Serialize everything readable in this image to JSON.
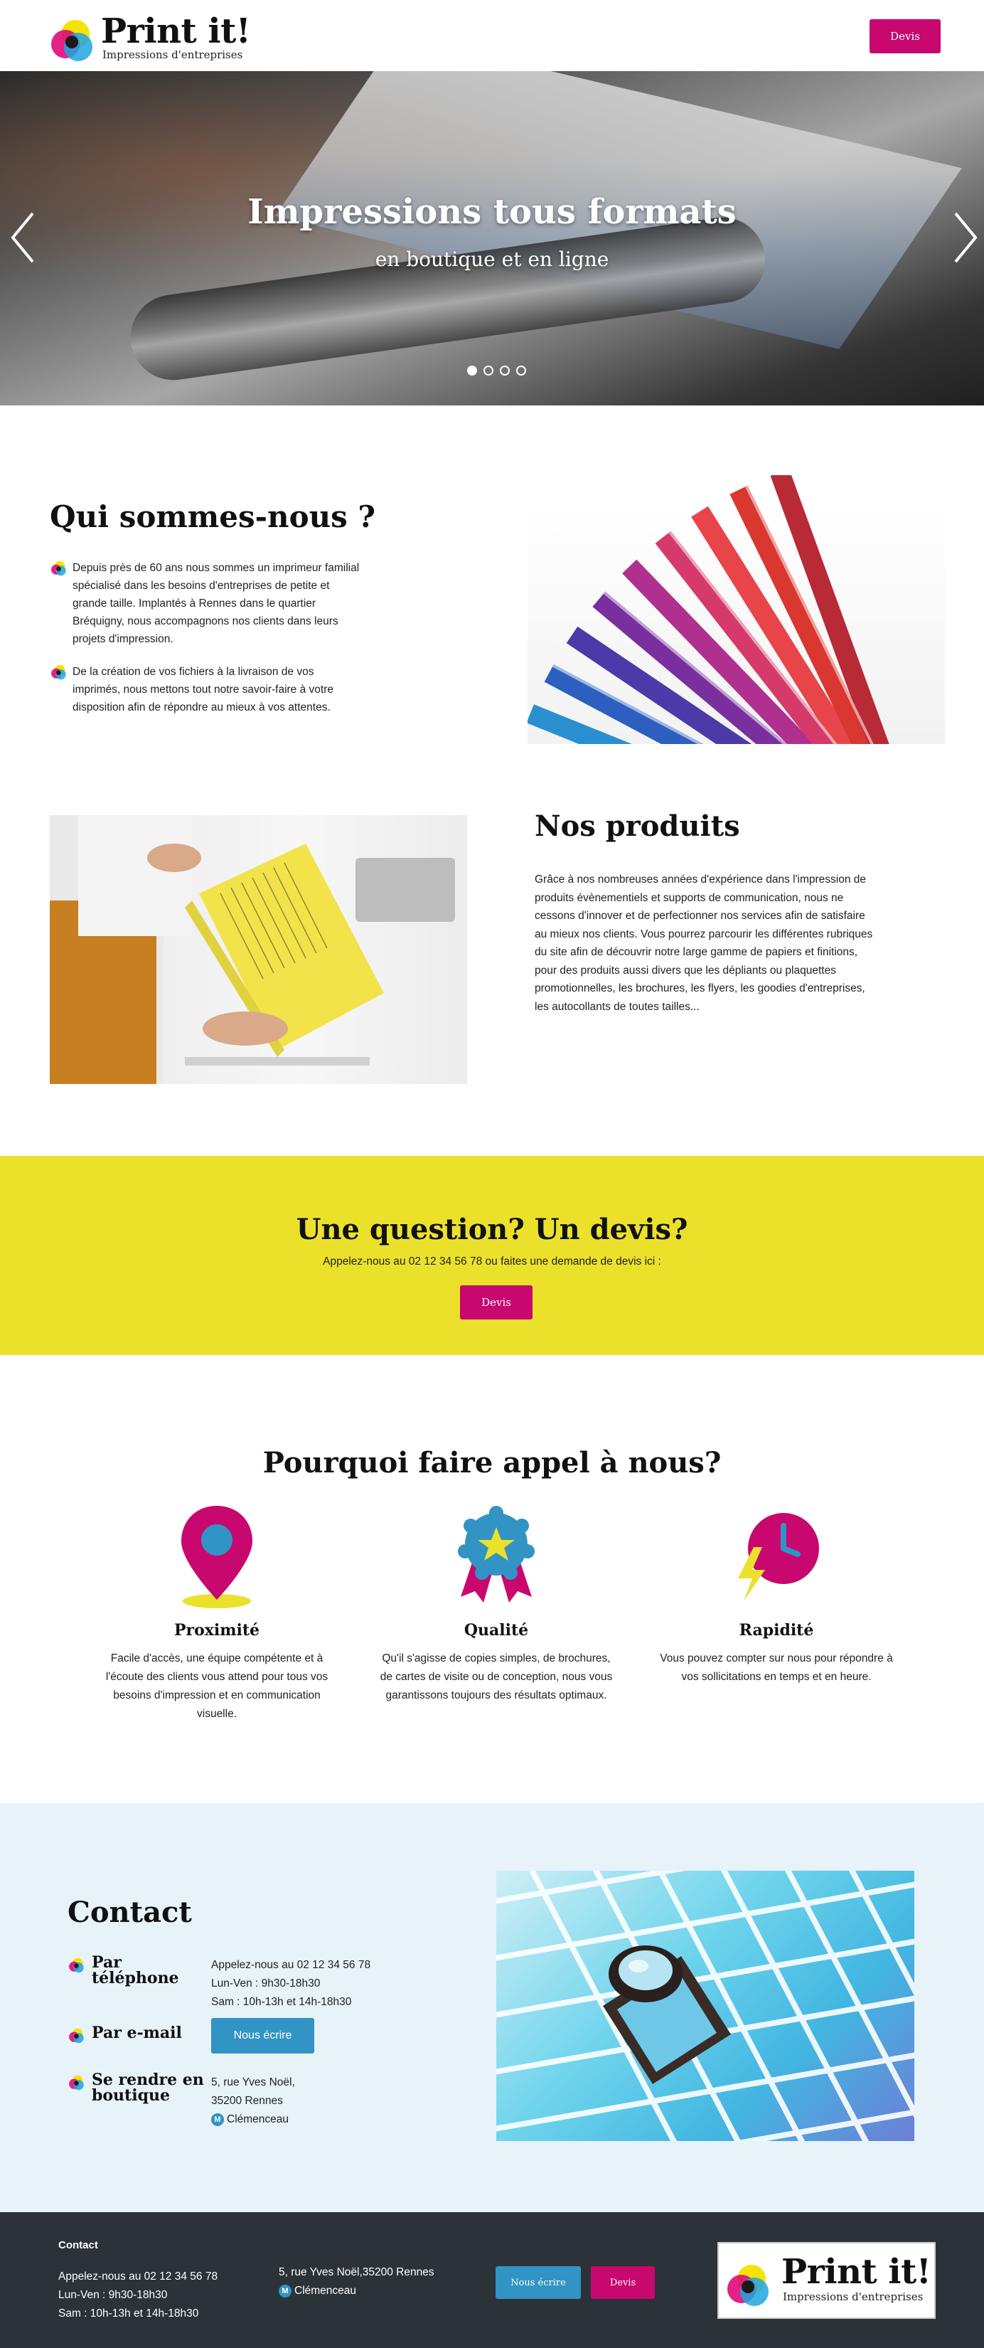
{
  "header": {
    "brand": "Print it!",
    "tagline": "Impressions d'entreprises",
    "devis_label": "Devis"
  },
  "hero": {
    "title": "Impressions tous formats",
    "subtitle": "en boutique et en ligne",
    "slides": 4,
    "active_slide": 1
  },
  "qui": {
    "title": "Qui sommes-nous ?",
    "bullets": [
      "Depuis près de 60 ans nous sommes un imprimeur familial spécialisé dans les besoins d'entreprises de petite et grande taille. Implantés à Rennes dans le quartier Bréquigny, nous accompagnons nos clients dans leurs projets d'impression.",
      "De la création de vos fichiers à la livraison de vos imprimés, nous mettons tout notre savoir-faire à votre disposition afin de répondre au mieux à vos attentes."
    ]
  },
  "produits": {
    "title": "Nos produits",
    "text": "Grâce à nos nombreuses années d'expérience dans l'impression de produits évènementiels et supports de communication, nous ne cessons d'innover et de perfectionner nos services afin de satisfaire au mieux nos clients. Vous pourrez parcourir les différentes rubriques du site afin de découvrir notre large gamme de papiers et finitions, pour des produits aussi divers que les dépliants ou plaquettes promotionnelles, les brochures, les flyers, les goodies d'entreprises, les autocollants de toutes tailles..."
  },
  "question": {
    "title": "Une question? Un devis?",
    "subtitle": "Appelez-nous au 02 12 34 56 78 ou faites une demande de devis ici :",
    "button": "Devis"
  },
  "pourquoi": {
    "title": "Pourquoi faire appel à nous?",
    "features": [
      {
        "name": "Proximité",
        "icon": "location-pin-icon",
        "text": "Facile d'accès, une équipe compétente et à l'écoute des clients vous attend pour tous vos besoins d'impression et en communication visuelle."
      },
      {
        "name": "Qualité",
        "icon": "award-badge-icon",
        "text": "Qu'il s'agisse de copies simples, de brochures, de cartes de visite ou de conception, nous vous garantissons toujours des résultats optimaux."
      },
      {
        "name": "Rapidité",
        "icon": "fast-clock-icon",
        "text": "Vous pouvez compter sur nous pour répondre à vos sollicitations en temps et en heure."
      }
    ]
  },
  "contact": {
    "title": "Contact",
    "phone_label": "Par téléphone",
    "phone_lines": [
      "Appelez-nous au 02 12 34 56 78",
      "Lun-Ven : 9h30-18h30",
      "Sam : 10h-13h et 14h-18h30"
    ],
    "email_label": "Par e-mail",
    "email_button": "Nous écrire",
    "shop_label": "Se rendre en boutique",
    "address_lines": [
      "5, rue Yves Noël,",
      "35200 Rennes"
    ],
    "metro_badge": "M",
    "metro_station": "Clémenceau"
  },
  "footer": {
    "heading": "Contact",
    "phone_lines": [
      "Appelez-nous au 02 12 34 56 78",
      "Lun-Ven : 9h30-18h30",
      "Sam : 10h-13h et 14h-18h30"
    ],
    "address": "5, rue Yves Noël,35200 Rennes",
    "metro_badge": "M",
    "metro_station": "Clémenceau",
    "ecrire_button": "Nous écrire",
    "devis_button": "Devis",
    "brand": "Print it!",
    "tagline": "Impressions d'entreprises"
  },
  "colors": {
    "magenta": "#c8086f",
    "blue": "#3194c4",
    "yellow": "#ebe12b",
    "light_blue_bg": "#e7f2f9",
    "footer_bg": "#2b3339"
  }
}
